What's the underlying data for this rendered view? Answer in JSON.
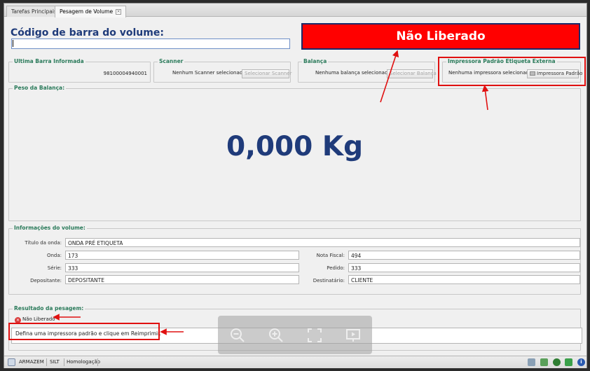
{
  "tabs": [
    {
      "label": "Tarefas Principais"
    },
    {
      "label": "Pesagem de Volume"
    }
  ],
  "barcode": {
    "title": "Código de barra do volume:",
    "value": ""
  },
  "status_banner": "Não Liberado",
  "last_barcode": {
    "legend": "Ultima Barra Informada",
    "value": "98100004940001"
  },
  "scanner": {
    "legend": "Scanner",
    "status": "Nenhum Scanner selecionado.",
    "button": "Selecionar Scanner"
  },
  "scale": {
    "legend": "Balança",
    "status": "Nenhuma balança selecionada.",
    "button": "Selecionar Balança"
  },
  "printer": {
    "legend": "Impressora Padrão Etiqueta Externa",
    "status": "Nenhuma impressora selecionada.",
    "button": "Impressora Padrão"
  },
  "weight": {
    "legend": "Peso da Balança:",
    "value": "0,000 Kg"
  },
  "volume_info": {
    "legend": "Informações do volume:",
    "titulo_label": "Título da onda:",
    "titulo_value": "ONDA PRÉ ETIQUETA",
    "onda_label": "Onda:",
    "onda_value": "173",
    "serie_label": "Série:",
    "serie_value": "333",
    "depositante_label": "Depositante:",
    "depositante_value": "DEPOSITANTE",
    "nota_label": "Nota Fiscal:",
    "nota_value": "494",
    "pedido_label": "Pedido:",
    "pedido_value": "333",
    "destinatario_label": "Destinatário:",
    "destinatario_value": "CLIENTE"
  },
  "result": {
    "legend": "Resultado da pesagem:",
    "status": "Não Liberado",
    "message": "Defina uma impressora padrão e clique em Reimprimir."
  },
  "statusbar": {
    "armazem": "ARMAZEM",
    "silt": "SILT",
    "env": "Homologação"
  },
  "colors": {
    "accent": "#1f3b7a",
    "banner": "#ff0000",
    "legend": "#2a7a5a",
    "highlight": "#e01010"
  }
}
